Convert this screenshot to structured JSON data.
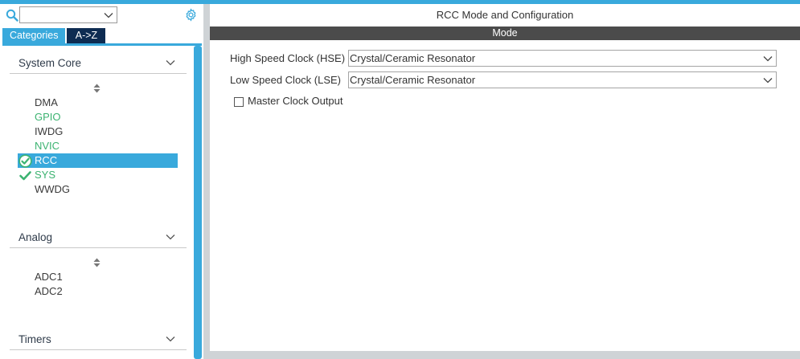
{
  "left_panel": {
    "search": {
      "value": "",
      "placeholder": ""
    },
    "tabs": {
      "categories": "Categories",
      "az": "A->Z"
    },
    "categories": [
      {
        "title": "System Core",
        "items": [
          {
            "label": "DMA",
            "state": "normal"
          },
          {
            "label": "GPIO",
            "state": "green"
          },
          {
            "label": "IWDG",
            "state": "normal"
          },
          {
            "label": "NVIC",
            "state": "green"
          },
          {
            "label": "RCC",
            "state": "selected"
          },
          {
            "label": "SYS",
            "state": "green-check"
          },
          {
            "label": "WWDG",
            "state": "normal"
          }
        ]
      },
      {
        "title": "Analog",
        "items": [
          {
            "label": "ADC1",
            "state": "normal"
          },
          {
            "label": "ADC2",
            "state": "normal"
          }
        ]
      },
      {
        "title": "Timers",
        "items": []
      }
    ]
  },
  "right_panel": {
    "title": "RCC Mode and Configuration",
    "section": "Mode",
    "hse": {
      "label": "High Speed Clock (HSE)",
      "value": "Crystal/Ceramic Resonator"
    },
    "lse": {
      "label": "Low Speed Clock (LSE)",
      "value": "Crystal/Ceramic Resonator"
    },
    "mco": {
      "label": "Master Clock Output",
      "checked": false
    }
  },
  "colors": {
    "accent": "#39a9dc",
    "tab_inactive": "#0e2c52",
    "enabled_green": "#3cb371",
    "mode_bar": "#4b4b4b"
  },
  "icons": [
    "search-icon",
    "gear-icon",
    "chevron-down-icon",
    "sort-icon",
    "check-circle-icon",
    "check-icon"
  ]
}
